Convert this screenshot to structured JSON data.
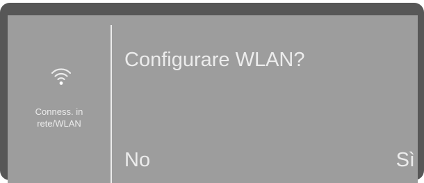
{
  "sidebar": {
    "icon": "wifi-icon",
    "label_line1": "Conness. in",
    "label_line2": "rete/WLAN"
  },
  "dialog": {
    "title": "Configurare WLAN?",
    "no_label": "No",
    "yes_label": "Sì"
  },
  "colors": {
    "bezel": "#575757",
    "screen": "#9d9d9d",
    "text": "#ececec"
  }
}
